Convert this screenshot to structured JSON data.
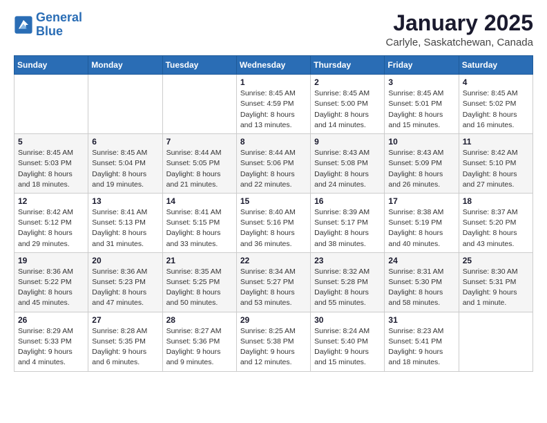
{
  "logo": {
    "line1": "General",
    "line2": "Blue"
  },
  "title": "January 2025",
  "location": "Carlyle, Saskatchewan, Canada",
  "weekdays": [
    "Sunday",
    "Monday",
    "Tuesday",
    "Wednesday",
    "Thursday",
    "Friday",
    "Saturday"
  ],
  "weeks": [
    [
      {
        "day": "",
        "info": ""
      },
      {
        "day": "",
        "info": ""
      },
      {
        "day": "",
        "info": ""
      },
      {
        "day": "1",
        "info": "Sunrise: 8:45 AM\nSunset: 4:59 PM\nDaylight: 8 hours\nand 13 minutes."
      },
      {
        "day": "2",
        "info": "Sunrise: 8:45 AM\nSunset: 5:00 PM\nDaylight: 8 hours\nand 14 minutes."
      },
      {
        "day": "3",
        "info": "Sunrise: 8:45 AM\nSunset: 5:01 PM\nDaylight: 8 hours\nand 15 minutes."
      },
      {
        "day": "4",
        "info": "Sunrise: 8:45 AM\nSunset: 5:02 PM\nDaylight: 8 hours\nand 16 minutes."
      }
    ],
    [
      {
        "day": "5",
        "info": "Sunrise: 8:45 AM\nSunset: 5:03 PM\nDaylight: 8 hours\nand 18 minutes."
      },
      {
        "day": "6",
        "info": "Sunrise: 8:45 AM\nSunset: 5:04 PM\nDaylight: 8 hours\nand 19 minutes."
      },
      {
        "day": "7",
        "info": "Sunrise: 8:44 AM\nSunset: 5:05 PM\nDaylight: 8 hours\nand 21 minutes."
      },
      {
        "day": "8",
        "info": "Sunrise: 8:44 AM\nSunset: 5:06 PM\nDaylight: 8 hours\nand 22 minutes."
      },
      {
        "day": "9",
        "info": "Sunrise: 8:43 AM\nSunset: 5:08 PM\nDaylight: 8 hours\nand 24 minutes."
      },
      {
        "day": "10",
        "info": "Sunrise: 8:43 AM\nSunset: 5:09 PM\nDaylight: 8 hours\nand 26 minutes."
      },
      {
        "day": "11",
        "info": "Sunrise: 8:42 AM\nSunset: 5:10 PM\nDaylight: 8 hours\nand 27 minutes."
      }
    ],
    [
      {
        "day": "12",
        "info": "Sunrise: 8:42 AM\nSunset: 5:12 PM\nDaylight: 8 hours\nand 29 minutes."
      },
      {
        "day": "13",
        "info": "Sunrise: 8:41 AM\nSunset: 5:13 PM\nDaylight: 8 hours\nand 31 minutes."
      },
      {
        "day": "14",
        "info": "Sunrise: 8:41 AM\nSunset: 5:15 PM\nDaylight: 8 hours\nand 33 minutes."
      },
      {
        "day": "15",
        "info": "Sunrise: 8:40 AM\nSunset: 5:16 PM\nDaylight: 8 hours\nand 36 minutes."
      },
      {
        "day": "16",
        "info": "Sunrise: 8:39 AM\nSunset: 5:17 PM\nDaylight: 8 hours\nand 38 minutes."
      },
      {
        "day": "17",
        "info": "Sunrise: 8:38 AM\nSunset: 5:19 PM\nDaylight: 8 hours\nand 40 minutes."
      },
      {
        "day": "18",
        "info": "Sunrise: 8:37 AM\nSunset: 5:20 PM\nDaylight: 8 hours\nand 43 minutes."
      }
    ],
    [
      {
        "day": "19",
        "info": "Sunrise: 8:36 AM\nSunset: 5:22 PM\nDaylight: 8 hours\nand 45 minutes."
      },
      {
        "day": "20",
        "info": "Sunrise: 8:36 AM\nSunset: 5:23 PM\nDaylight: 8 hours\nand 47 minutes."
      },
      {
        "day": "21",
        "info": "Sunrise: 8:35 AM\nSunset: 5:25 PM\nDaylight: 8 hours\nand 50 minutes."
      },
      {
        "day": "22",
        "info": "Sunrise: 8:34 AM\nSunset: 5:27 PM\nDaylight: 8 hours\nand 53 minutes."
      },
      {
        "day": "23",
        "info": "Sunrise: 8:32 AM\nSunset: 5:28 PM\nDaylight: 8 hours\nand 55 minutes."
      },
      {
        "day": "24",
        "info": "Sunrise: 8:31 AM\nSunset: 5:30 PM\nDaylight: 8 hours\nand 58 minutes."
      },
      {
        "day": "25",
        "info": "Sunrise: 8:30 AM\nSunset: 5:31 PM\nDaylight: 9 hours\nand 1 minute."
      }
    ],
    [
      {
        "day": "26",
        "info": "Sunrise: 8:29 AM\nSunset: 5:33 PM\nDaylight: 9 hours\nand 4 minutes."
      },
      {
        "day": "27",
        "info": "Sunrise: 8:28 AM\nSunset: 5:35 PM\nDaylight: 9 hours\nand 6 minutes."
      },
      {
        "day": "28",
        "info": "Sunrise: 8:27 AM\nSunset: 5:36 PM\nDaylight: 9 hours\nand 9 minutes."
      },
      {
        "day": "29",
        "info": "Sunrise: 8:25 AM\nSunset: 5:38 PM\nDaylight: 9 hours\nand 12 minutes."
      },
      {
        "day": "30",
        "info": "Sunrise: 8:24 AM\nSunset: 5:40 PM\nDaylight: 9 hours\nand 15 minutes."
      },
      {
        "day": "31",
        "info": "Sunrise: 8:23 AM\nSunset: 5:41 PM\nDaylight: 9 hours\nand 18 minutes."
      },
      {
        "day": "",
        "info": ""
      }
    ]
  ]
}
